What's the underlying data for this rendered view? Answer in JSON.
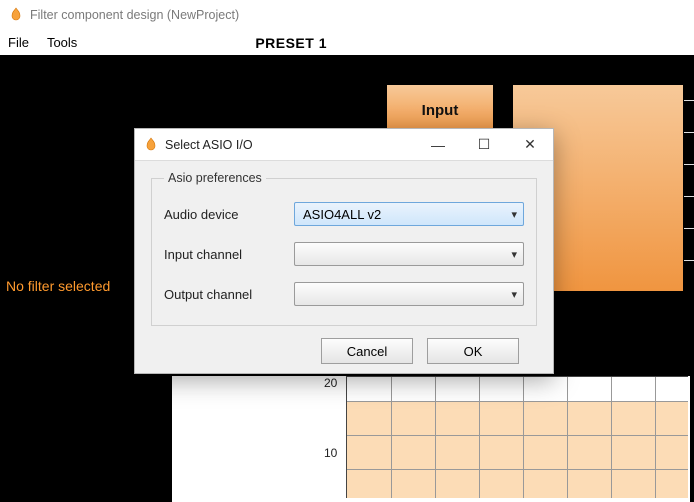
{
  "window": {
    "title": "Filter component design (NewProject)"
  },
  "menubar": {
    "items": [
      "File",
      "Tools"
    ],
    "preset_label": "PRESET 1"
  },
  "work": {
    "input_block_label": "Input",
    "status_text": "No filter selected",
    "graph": {
      "yticks": [
        "20",
        "10"
      ]
    }
  },
  "dialog": {
    "title": "Select ASIO I/O",
    "group_label": "Asio preferences",
    "controls": {
      "minimize": "—",
      "maximize": "☐",
      "close": "✕"
    },
    "fields": {
      "audio_device": {
        "label": "Audio device",
        "value": "ASIO4ALL v2"
      },
      "input_channel": {
        "label": "Input channel",
        "value": ""
      },
      "output_channel": {
        "label": "Output channel",
        "value": ""
      }
    },
    "buttons": {
      "cancel": "Cancel",
      "ok": "OK"
    }
  }
}
